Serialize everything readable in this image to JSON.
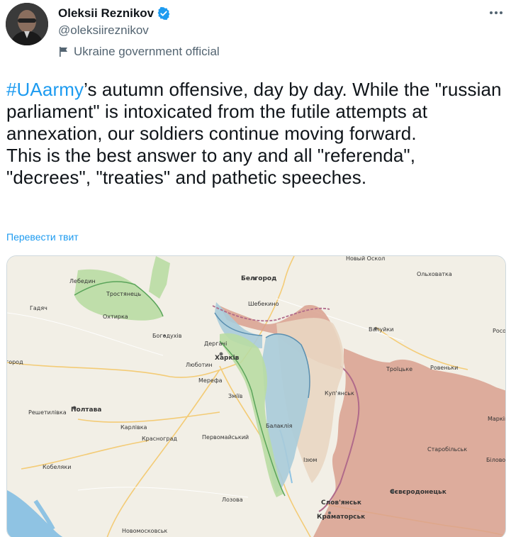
{
  "author": {
    "display_name": "Oleksii Reznikov",
    "handle": "@oleksiireznikov",
    "label": "Ukraine government official"
  },
  "tweet": {
    "hashtag": "#UAarmy",
    "text_after_hashtag": "’s autumn offensive, day by day. While the \"russian parliament\" is intoxicated from the futile attempts at annexation, our soldiers continue moving forward.\nThis is the best answer to any and all \"referenda\", \"decrees\", \"treaties\" and pathetic speeches.",
    "translate_link": "Перевести твит"
  },
  "map": {
    "labels": {
      "belgorod": "Белгород",
      "olkhovatka": "Ольховатка",
      "lebedin": "Лебедин",
      "trostyanets": "Тростянець",
      "okhtyrka": "Охтирка",
      "gadyach": "Гадяч",
      "shebekino": "Шебекино",
      "valuyki": "Валуйки",
      "bohodukhiv": "Богодухів",
      "dergachi": "Дергачі",
      "kharkiv": "Харків",
      "lyubotyn": "Люботин",
      "merefa": "Мерефа",
      "zmiiv": "Зміїв",
      "rovenki": "Ровеньки",
      "troitske": "Троїцьке",
      "kupiansk": "Куп'янськ",
      "poltava": "Полтава",
      "reshetylivka": "Решетилівка",
      "karlivka": "Карлівка",
      "krasnohrad": "Красноград",
      "pervomaiskyi": "Первомайський",
      "balakliia": "Балаклія",
      "izium": "Ізюм",
      "starobilsk": "Старобільськ",
      "markivka": "Марків",
      "bilovodsk": "Біловод",
      "kobeliaky": "Кобеляки",
      "lozova": "Лозова",
      "sloviansk": "Слов'янськ",
      "kramatorsk": "Краматорськ",
      "sievierodonetsk": "Сєвєродонецьк",
      "novomoskovsk": "Новомосковськ",
      "rossosh": "Росо",
      "horod": "город",
      "novyi_oskol": "Новый Оскол"
    },
    "colors": {
      "background": "#f2efe6",
      "russian_occupied": "#d9a08e",
      "liberated_blue": "#a9cbd9",
      "liberated_green": "#b9dca3",
      "contested_beige": "#e9d6c2",
      "border_line": "#b06a8a",
      "water": "#8fc3e3"
    }
  }
}
